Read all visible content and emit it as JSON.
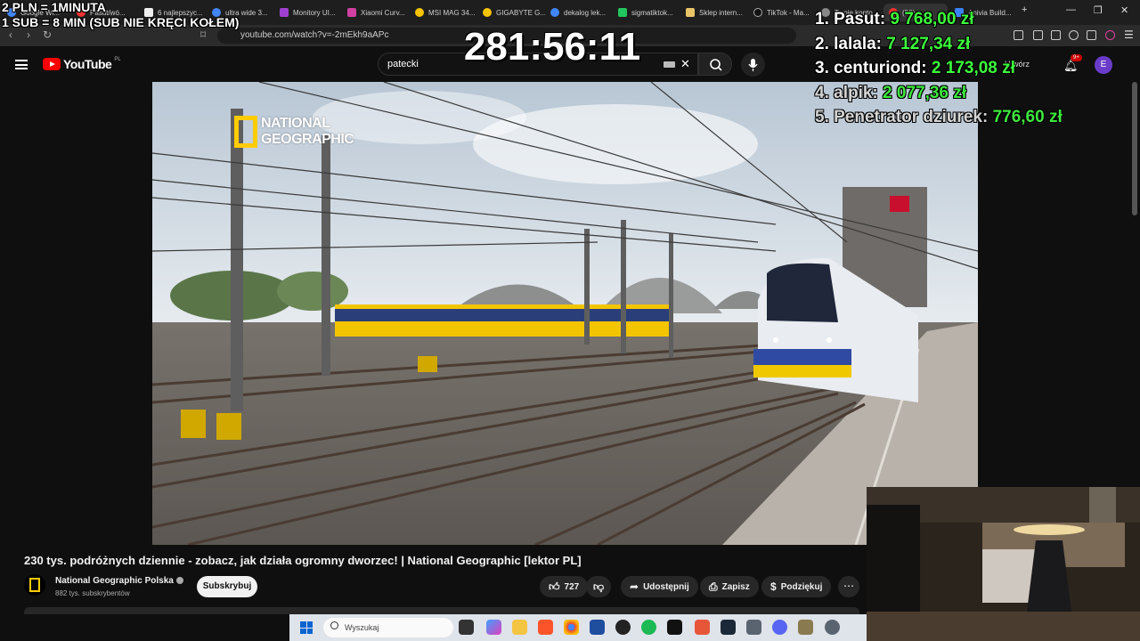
{
  "browser": {
    "tabs": [
      "Google Wi...",
      "Pasut/wó...",
      "6 najlepszyc...",
      "ultra wide 3...",
      "Monitory UI...",
      "Xiaomi Curv...",
      "MSI MAG 34...",
      "GIGABYTE G...",
      "dekalog lek...",
      "sigmatiktok...",
      "Sklep intern...",
      "TikTok - Ma...",
      "Twoje konto...",
      "(56)...",
      "Anivia Build..."
    ],
    "url": "youtube.com/watch?v=-2mEkh9aAPc",
    "window_controls": [
      "—",
      "❐",
      "✕"
    ],
    "new_tab": "+"
  },
  "youtube": {
    "logo_text": "YouTube",
    "country_code": "PL",
    "search_value": "patecki",
    "create_label": "Utwórz",
    "notifications_badge": "9+",
    "avatar_letter": "E"
  },
  "video": {
    "title": "230 tys. podróżnych dziennie - zobacz, jak działa ogromny dworzec! | National Geographic [lektor PL]",
    "watermark_line1": "NATIONAL",
    "watermark_line2": "GEOGRAPHIC",
    "channel_name": "National Geographic Polska",
    "channel_subs": "882 tys. subskrybentów",
    "subscribe_label": "Subskrybuj",
    "likes": "727",
    "share_label": "Udostępnij",
    "save_label": "Zapisz",
    "thanks_label": "Podziękuj",
    "more_label": "⋯"
  },
  "overlay": {
    "rate_line1": "2 PLN =  1MINUTA",
    "rate_line2": "1 SUB = 8 MIN (SUB NIE KRĘCI KOŁEM)",
    "timer": "281:56:11",
    "leaderboard": [
      {
        "name": "1. Pasut:",
        "amount": "9 768,00 zł"
      },
      {
        "name": "2. lalala:",
        "amount": "7 127,34 zł"
      },
      {
        "name": "3. centuriond:",
        "amount": "2 173,08 zł"
      },
      {
        "name": "4. alpik:",
        "amount": "2 077,36 zł"
      },
      {
        "name": "5. Penetrator dziurek:",
        "amount": "776,60 zł"
      }
    ]
  },
  "taskbar": {
    "search_placeholder": "Wyszukaj"
  },
  "colors": {
    "accent_red": "#ff0000",
    "natgeo_yellow": "#ffcc00",
    "leader_green": "#3dff3d",
    "avatar_purple": "#6a3cc9"
  }
}
